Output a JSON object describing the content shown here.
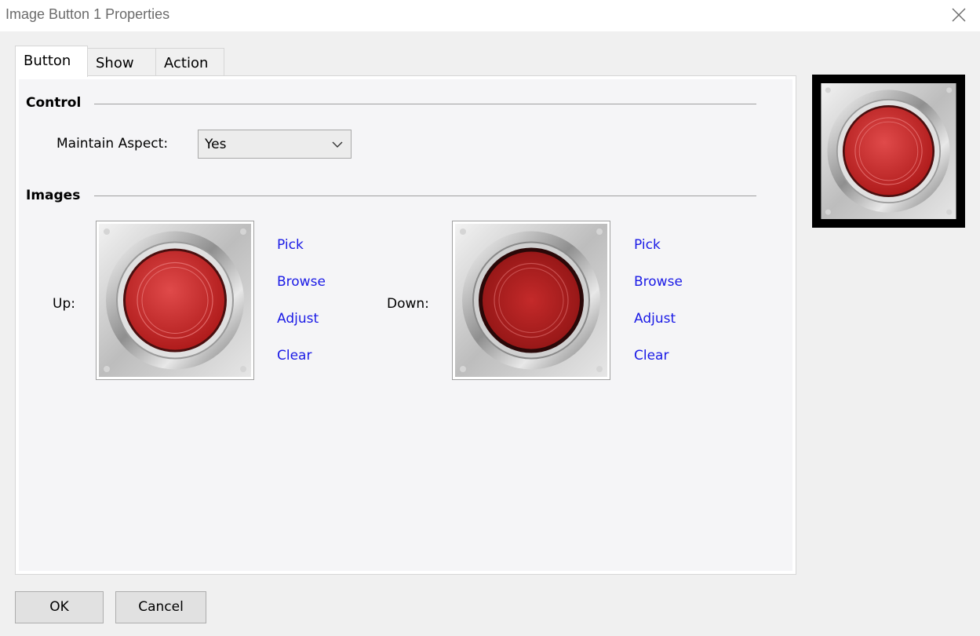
{
  "window": {
    "title": "Image Button 1 Properties"
  },
  "tabs": [
    {
      "label": "Button"
    },
    {
      "label": "Show"
    },
    {
      "label": "Action"
    }
  ],
  "control": {
    "heading": "Control",
    "maintain_aspect_label": "Maintain Aspect:",
    "maintain_aspect_value": "Yes"
  },
  "images": {
    "heading": "Images",
    "up": {
      "label": "Up:",
      "actions": [
        "Pick",
        "Browse",
        "Adjust",
        "Clear"
      ]
    },
    "down": {
      "label": "Down:",
      "actions": [
        "Pick",
        "Browse",
        "Adjust",
        "Clear"
      ]
    }
  },
  "footer": {
    "ok_label": "OK",
    "cancel_label": "Cancel"
  },
  "colors": {
    "link": "#1a1ae6",
    "button_red": "#d32f2f",
    "button_red_down": "#b71c1c"
  },
  "icons": {
    "close": "close-icon",
    "dropdown": "chevron-down-icon"
  }
}
